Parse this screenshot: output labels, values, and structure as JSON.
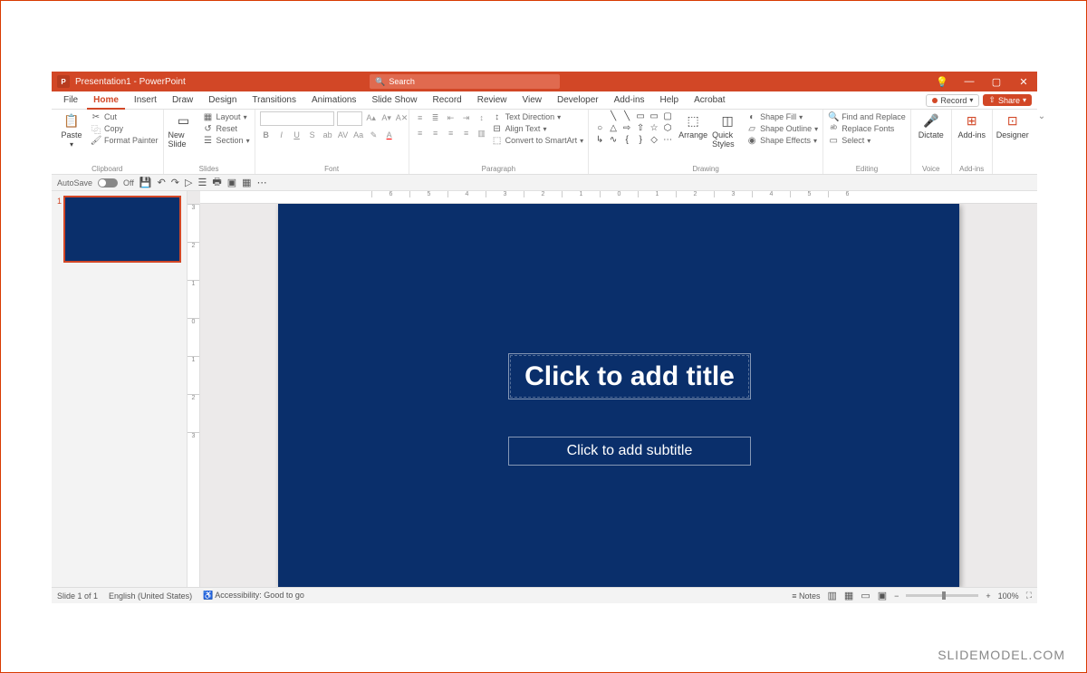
{
  "window": {
    "title": "Presentation1 - PowerPoint",
    "minimize": "—",
    "maximize": "▢",
    "close": "✕"
  },
  "search": {
    "placeholder": "Search"
  },
  "tabs": {
    "file": "File",
    "home": "Home",
    "insert": "Insert",
    "draw": "Draw",
    "design": "Design",
    "transitions": "Transitions",
    "animations": "Animations",
    "slideshow": "Slide Show",
    "record": "Record",
    "review": "Review",
    "view": "View",
    "developer": "Developer",
    "addins": "Add-ins",
    "help": "Help",
    "acrobat": "Acrobat"
  },
  "topright": {
    "record": "Record",
    "share": "Share"
  },
  "ribbon": {
    "clipboard": {
      "label": "Clipboard",
      "paste": "Paste",
      "cut": "Cut",
      "copy": "Copy",
      "fmt": "Format Painter"
    },
    "slides": {
      "label": "Slides",
      "new": "New Slide",
      "layout": "Layout",
      "reset": "Reset",
      "section": "Section"
    },
    "font": {
      "label": "Font"
    },
    "paragraph": {
      "label": "Paragraph",
      "textdir": "Text Direction",
      "align": "Align Text",
      "smartart": "Convert to SmartArt"
    },
    "drawing": {
      "label": "Drawing",
      "arrange": "Arrange",
      "quick": "Quick Styles",
      "fill": "Shape Fill",
      "outline": "Shape Outline",
      "effects": "Shape Effects"
    },
    "editing": {
      "label": "Editing",
      "find": "Find and Replace",
      "replace": "Replace Fonts",
      "select": "Select"
    },
    "voice": {
      "label": "Voice",
      "dictate": "Dictate"
    },
    "addins": {
      "label": "Add-ins",
      "addins_btn": "Add-ins"
    },
    "designer": {
      "label": "",
      "designer": "Designer"
    }
  },
  "qat": {
    "autosave": "AutoSave",
    "off": "Off"
  },
  "thumb": {
    "num": "1"
  },
  "slide": {
    "title": "Click to add title",
    "subtitle": "Click to add subtitle"
  },
  "status": {
    "slide": "Slide 1 of 1",
    "lang": "English (United States)",
    "acc": "Accessibility: Good to go",
    "notes": "Notes",
    "zoom": "100%"
  },
  "watermark": "SLIDEMODEL.COM",
  "ruler_ticks": [
    "6",
    "5",
    "4",
    "3",
    "2",
    "1",
    "0",
    "1",
    "2",
    "3",
    "4",
    "5",
    "6"
  ]
}
